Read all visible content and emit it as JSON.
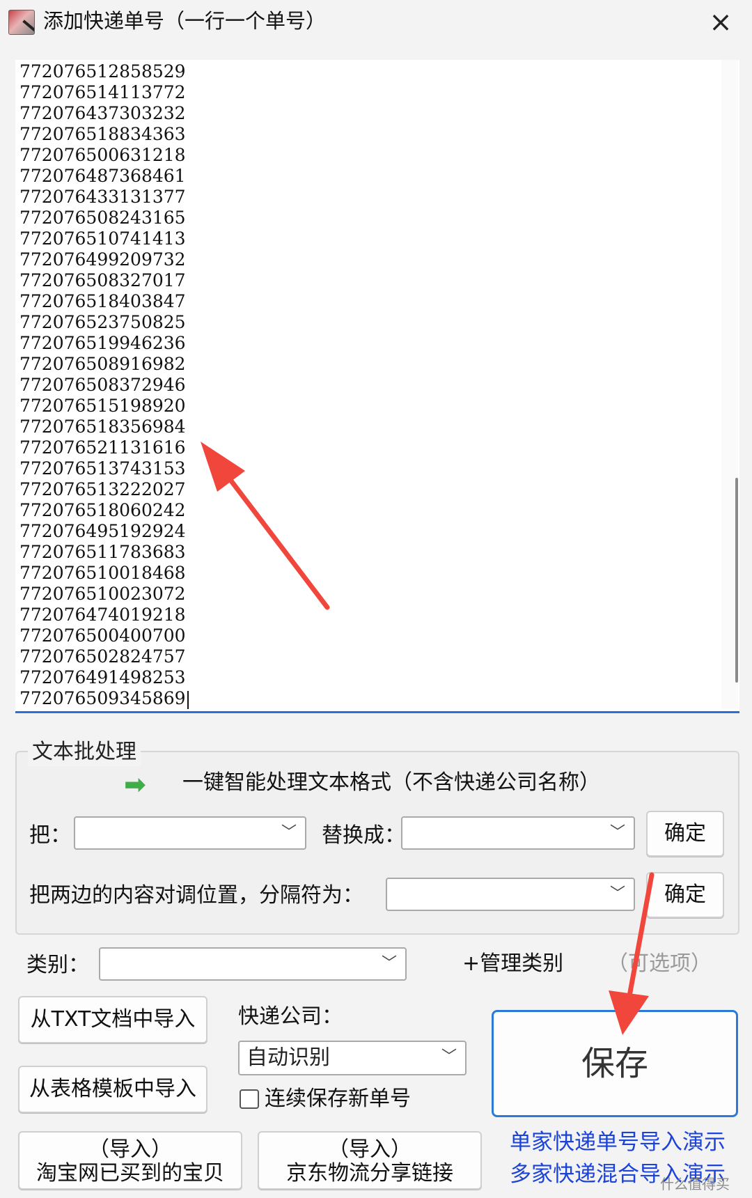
{
  "window": {
    "title": "添加快递单号（一行一个单号）",
    "close_icon": "×"
  },
  "tracking_numbers": [
    "772076512858529",
    "772076514113772",
    "772076437303232",
    "772076518834363",
    "772076500631218",
    "772076487368461",
    "772076433131377",
    "772076508243165",
    "772076510741413",
    "772076499209732",
    "772076508327017",
    "772076518403847",
    "772076523750825",
    "772076519946236",
    "772076508916982",
    "772076508372946",
    "772076515198920",
    "772076518356984",
    "772076521131616",
    "772076513743153",
    "772076513222027",
    "772076518060242",
    "772076495192924",
    "772076511783683",
    "772076510018468",
    "772076510023072",
    "772076474019218",
    "772076500400700",
    "772076502824757",
    "772076491498253",
    "772076509345869"
  ],
  "batch": {
    "title": "文本批处理",
    "arrow_icon": "➡",
    "smart_format_label": "一键智能处理文本格式（不含快递公司名称）",
    "replace_from_label": "把：",
    "replace_to_label": "替换成：",
    "confirm_label": "确定",
    "swap_label": "把两边的内容对调位置，分隔符为：",
    "confirm2_label": "确定"
  },
  "category": {
    "label": "类别：",
    "manage_label": "+管理类别",
    "optional_label": "（可选项）"
  },
  "import": {
    "txt_label": "从TXT文档中导入",
    "table_label": "从表格模板中导入",
    "taobao_line1": "（导入）",
    "taobao_line2": "淘宝网已买到的宝贝",
    "jd_line1": "（导入）",
    "jd_line2": "京东物流分享链接"
  },
  "courier": {
    "label": "快递公司：",
    "selected": "自动识别",
    "continuous_label": "连续保存新单号"
  },
  "save_label": "保存",
  "demo_links": {
    "single": "单家快递单号导入演示",
    "multi": "多家快递混合导入演示"
  },
  "watermark": "什么值得买",
  "colors": {
    "accent_blue": "#2b6fd6",
    "link_blue": "#1c43d8",
    "annotation_red": "#f0463c",
    "green_arrow": "#3fae49"
  }
}
